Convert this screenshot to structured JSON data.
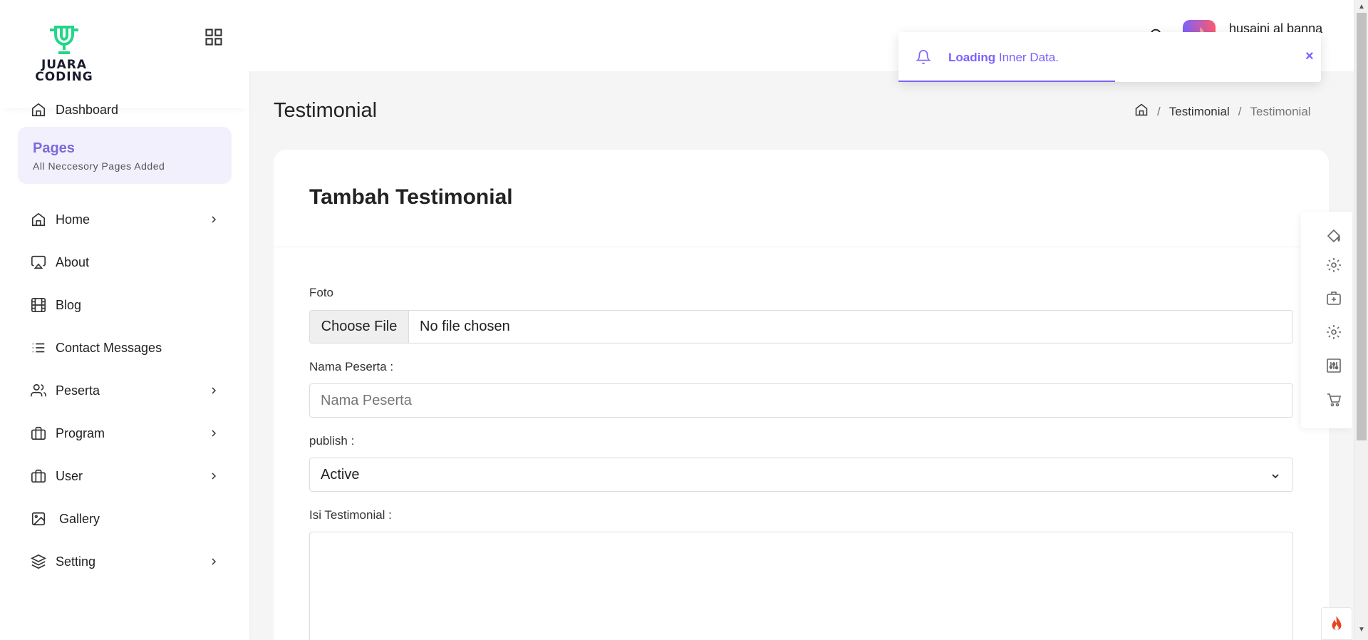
{
  "sidebar": {
    "logo_text_line1": "JUARA",
    "logo_text_line2": "CODING",
    "dashboard_label": "Dashboard",
    "pages_card": {
      "title": "Pages",
      "subtitle": "All Neccesory Pages Added"
    },
    "items": [
      {
        "label": "Home",
        "icon": "home-icon",
        "has_submenu": true
      },
      {
        "label": "About",
        "icon": "airplay-icon",
        "has_submenu": false
      },
      {
        "label": "Blog",
        "icon": "film-icon",
        "has_submenu": false
      },
      {
        "label": "Contact Messages",
        "icon": "list-icon",
        "has_submenu": false
      },
      {
        "label": "Peserta",
        "icon": "users-icon",
        "has_submenu": true
      },
      {
        "label": "Program",
        "icon": "briefcase-icon",
        "has_submenu": true
      },
      {
        "label": "User",
        "icon": "briefcase-icon",
        "has_submenu": true
      },
      {
        "label": "Gallery",
        "icon": "image-icon",
        "has_submenu": false
      },
      {
        "label": "Setting",
        "icon": "layers-icon",
        "has_submenu": true
      }
    ]
  },
  "header": {
    "username": "husaini al banna"
  },
  "toast": {
    "bold": "Loading",
    "message": "Inner Data.",
    "close": "×"
  },
  "page": {
    "title": "Testimonial",
    "breadcrumb": {
      "level1": "Testimonial",
      "level2": "Testimonial",
      "separator": "/"
    }
  },
  "form": {
    "card_title": "Tambah Testimonial",
    "foto_label": "Foto",
    "file_button": "Choose File",
    "file_status": "No file chosen",
    "nama_label": "Nama Peserta :",
    "nama_placeholder": "Nama Peserta",
    "publish_label": "publish :",
    "publish_value": "Active",
    "isi_label": "Isi Testimonial :"
  },
  "colors": {
    "accent": "#7b61ff",
    "logo_green": "#22c55e",
    "pages_bg": "#f2f0fd"
  }
}
